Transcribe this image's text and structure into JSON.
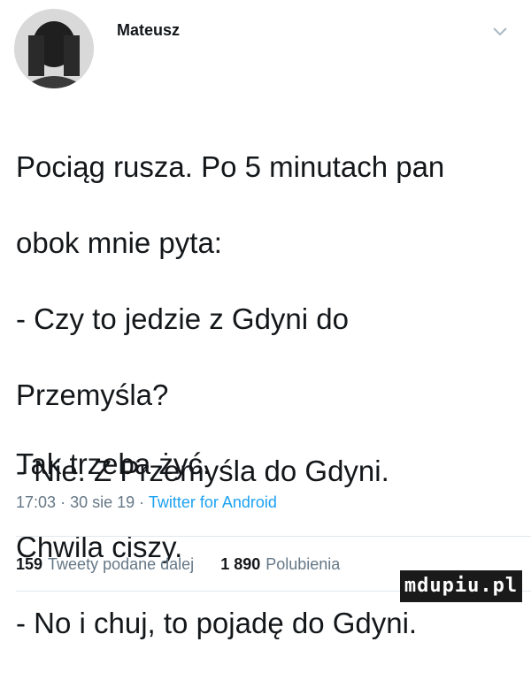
{
  "author": {
    "name": "Mateusz",
    "avatar_icon": "user-avatar"
  },
  "header": {
    "menu_icon": "chevron-down-icon"
  },
  "tweet": {
    "lines": [
      "Pociąg rusza. Po 5 minutach pan",
      "obok mnie pyta:",
      "- Czy to jedzie z Gdyni do",
      "Przemyśla?",
      "- Nie. Z Przemyśla do Gdyni.",
      "Chwila ciszy.",
      "- No i chuj, to pojadę do Gdyni."
    ],
    "closing": "Tak trzeba żyć."
  },
  "meta": {
    "time": "17:03",
    "date": "30 sie 19",
    "separator": "·",
    "source": "Twitter for Android"
  },
  "stats": {
    "retweets_count": "159",
    "retweets_label": "Tweety podane dalej",
    "likes_count": "1 890",
    "likes_label": "Polubienia"
  },
  "watermark": "mdupiu.pl",
  "colors": {
    "text": "#14171a",
    "muted": "#657786",
    "link": "#1da1f2",
    "divider": "#e1e8ed"
  }
}
